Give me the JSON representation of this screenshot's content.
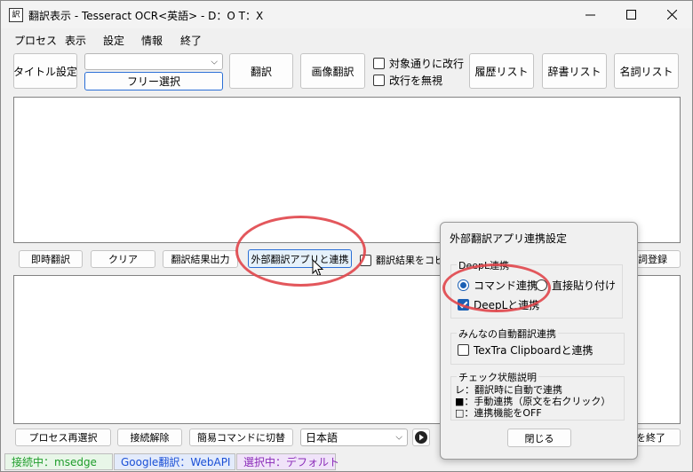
{
  "window": {
    "title": "翻訳表示 - Tesseract OCR<英語> - D：O T：X",
    "app_icon_glyph": "訳"
  },
  "menu": [
    "プロセス",
    "表示",
    "設定",
    "情報",
    "終了"
  ],
  "toolbar": {
    "title_settings": "タイトル設定",
    "combo_value": "",
    "free_select": "フリー選択",
    "translate": "翻訳",
    "image_translate": "画像翻訳",
    "line_break_as_is": "対象通りに改行",
    "ignore_line_breaks": "改行を無視",
    "history_list": "履歴リスト",
    "dictionary_list": "辞書リスト",
    "noun_list": "名詞リスト"
  },
  "middle_bar": {
    "instant_translate": "即時翻訳",
    "clear": "クリア",
    "output_result": "翻訳結果出力",
    "external_link": "外部翻訳アプリと連携",
    "copy_result": "翻訳結果をコピ",
    "register_partial": "詞登録"
  },
  "bottom_bar": {
    "reselect_process": "プロセス再選択",
    "disconnect": "接続解除",
    "simple_command": "簡易コマンドに切替",
    "language": "日本語",
    "end_partial": "を終了"
  },
  "status": {
    "connected": "接続中：msedge",
    "google": "Google翻訳：WebAPI",
    "selected": "選択中：デフォルト"
  },
  "dialog": {
    "title": "外部翻訳アプリ連携設定",
    "deepl_group": "DeepL連携",
    "command_link": "コマンド連携",
    "direct_paste": "直接貼り付け",
    "link_with_deepl": "DeepLと連携",
    "minna_group": "みんなの自動翻訳連携",
    "textra_clipboard": "TexTra Clipboardと連携",
    "check_group": "チェック状態説明",
    "legend_auto": "レ：翻訳時に自動で連携",
    "legend_manual": "■：手動連携（原文を右クリック）",
    "legend_off": "□：連携機能をOFF",
    "close": "閉じる"
  },
  "colors": {
    "accent": "#1a5fb4",
    "highlight_circle": "#e0454a",
    "status_connected": "#1e9c2a",
    "status_google": "#1a4fd6",
    "status_selected": "#8a2bb8"
  }
}
